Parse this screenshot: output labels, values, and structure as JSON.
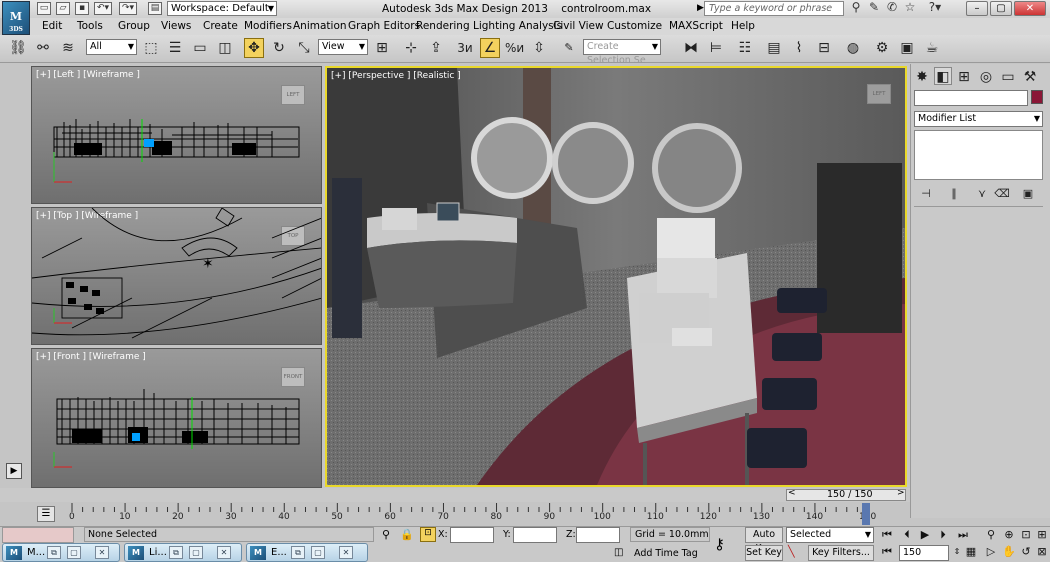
{
  "app": {
    "title": "Autodesk 3ds Max Design 2013",
    "file": "controlroom.max",
    "logo": "3DS",
    "workspace": "Workspace: Default",
    "search_placeholder": "Type a keyword or phrase"
  },
  "menus": [
    "Edit",
    "Tools",
    "Group",
    "Views",
    "Create",
    "Modifiers",
    "Animation",
    "Graph Editors",
    "Rendering",
    "Lighting Analysis",
    "Civil View",
    "Customize",
    "MAXScript",
    "Help"
  ],
  "toolbar": {
    "selection_filter": "All",
    "reference_coord": "View",
    "named_selection_placeholder": "Create Selection Se",
    "snap_label": "3",
    "percent_label": "%"
  },
  "viewports": {
    "left": {
      "label": "[+] [Left ] [Wireframe ]",
      "cube": "LEFT"
    },
    "top": {
      "label": "[+] [Top ] [Wireframe ]",
      "cube": "TOP"
    },
    "front": {
      "label": "[+] [Front ] [Wireframe ]",
      "cube": "FRONT"
    },
    "perspective": {
      "label": "[+] [Perspective ] [Realistic ]",
      "cube": "LEFT"
    }
  },
  "command_panel": {
    "modifier_list": "Modifier List",
    "object_color": "#8a1636"
  },
  "timeline": {
    "frame_display": "150 / 150",
    "ticks": [
      "0",
      "10",
      "20",
      "30",
      "40",
      "50",
      "60",
      "70",
      "80",
      "90",
      "100",
      "110",
      "120",
      "130",
      "140",
      "150"
    ]
  },
  "status": {
    "selection": "None Selected",
    "x_label": "X:",
    "y_label": "Y:",
    "z_label": "Z:",
    "grid": "Grid = 10.0mm",
    "auto_key": "Auto Key",
    "set_key": "Set Key",
    "key_mode": "Selected",
    "key_filters": "Key Filters...",
    "add_time_tag": "Add Time Tag",
    "current_frame": "150"
  },
  "taskbar": [
    {
      "label": "M..."
    },
    {
      "label": "Li..."
    },
    {
      "label": "E..."
    }
  ],
  "colors": {
    "active_viewport_border": "#e9d82a",
    "snap_active": "#f3d25e"
  }
}
